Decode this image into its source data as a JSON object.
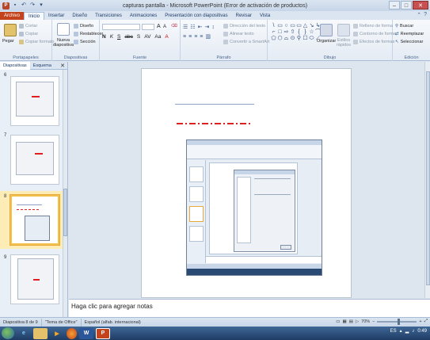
{
  "window": {
    "title": "capturas pantalla - Microsoft PowerPoint (Error de activación de productos)",
    "quick_access": [
      "P",
      "save-icon",
      "undo-icon",
      "redo-icon",
      "dropdown-icon"
    ],
    "controls": [
      "–",
      "□",
      "✕"
    ]
  },
  "ribbon_tabs": [
    "Archivo",
    "Inicio",
    "Insertar",
    "Diseño",
    "Transiciones",
    "Animaciones",
    "Presentación con diapositivas",
    "Revisar",
    "Vista"
  ],
  "ribbon": {
    "portapapeles": {
      "label": "Portapapeles",
      "paste": "Pegar",
      "cut": "Cortar",
      "copy": "Copiar",
      "format_painter": "Copiar formato"
    },
    "diapositivas": {
      "label": "Diapositivas",
      "new_slide": "Nueva diapositiva",
      "layout": "Diseño",
      "reset": "Restablecer",
      "section": "Sección"
    },
    "fuente": {
      "label": "Fuente",
      "buttons": [
        "N",
        "K",
        "S",
        "abc",
        "S",
        "AV",
        "Aa",
        "A"
      ],
      "grow": "A",
      "shrink": "A"
    },
    "parrafo": {
      "label": "Párrafo",
      "text_direction": "Dirección del texto",
      "align_text": "Alinear texto",
      "smartart": "Convertir a SmartArt"
    },
    "dibujo": {
      "label": "Dibujo",
      "shapes": [
        "\\",
        "▭",
        "○",
        "▭",
        "▭",
        "△",
        "↘",
        "↳",
        "⌐",
        "□",
        "⇨",
        "⇧",
        "{",
        "}",
        "☆",
        "⌒",
        "⬠",
        "⬡",
        "⌓",
        "⊙",
        "⚲",
        "☐",
        "⬭",
        "⟋"
      ],
      "arrange": "Organizar",
      "quick_styles": "Estilos rápidos",
      "fill": "Relleno de forma",
      "outline": "Contorno de forma",
      "effects": "Efectos de formas"
    },
    "edicion": {
      "label": "Edición",
      "find": "Buscar",
      "replace": "Reemplazar",
      "select": "Seleccionar"
    }
  },
  "left_pane": {
    "tabs": [
      "Diapositivas",
      "Esquema"
    ],
    "close": "✕",
    "thumbnails": [
      {
        "number": "6",
        "selected": false
      },
      {
        "number": "7",
        "selected": false
      },
      {
        "number": "8",
        "selected": true
      },
      {
        "number": "9",
        "selected": false
      }
    ]
  },
  "notes": {
    "placeholder": "Haga clic para agregar notas"
  },
  "status": {
    "slide_info": "Diapositiva 8 de 9",
    "theme": "\"Tema de Office\"",
    "language": "Español (alfab. internacional)",
    "zoom": "70%",
    "zoom_level": 0.55
  },
  "taskbar": {
    "apps": [
      "ie-icon",
      "explorer-icon",
      "media-icon",
      "firefox-icon",
      "word-icon",
      "powerpoint-icon"
    ],
    "language": "ES",
    "time": "0:49"
  },
  "colors": {
    "file_tab": "#c2431c",
    "accent": "#2b579a",
    "slide_dash": "#e02020",
    "selected_thumb": "#f0c24b"
  }
}
